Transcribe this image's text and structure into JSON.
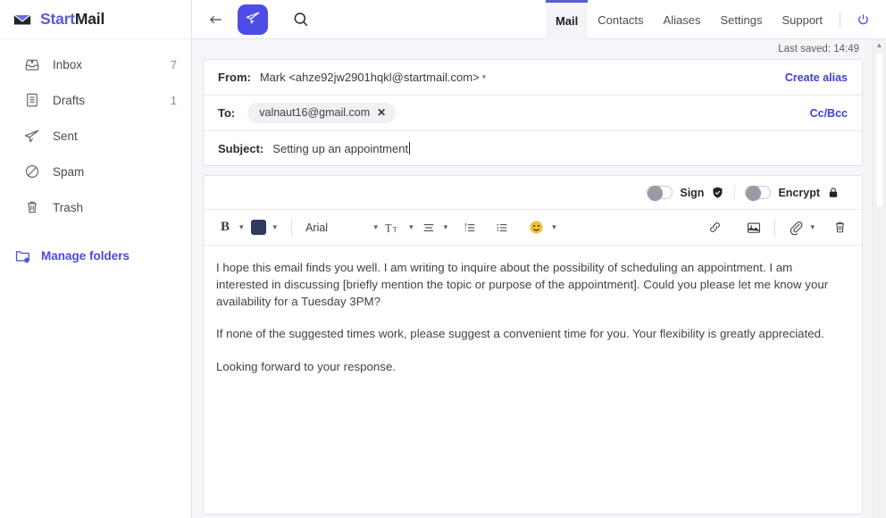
{
  "brand": {
    "start": "Start",
    "mail": "Mail",
    "logo_icon": "envelope-icon"
  },
  "sidebar": {
    "folders": [
      {
        "label": "Inbox",
        "count": "7",
        "icon": "inbox-tray-icon"
      },
      {
        "label": "Drafts",
        "count": "1",
        "icon": "document-icon"
      },
      {
        "label": "Sent",
        "count": "",
        "icon": "paper-plane-icon"
      },
      {
        "label": "Spam",
        "count": "",
        "icon": "no-entry-icon"
      },
      {
        "label": "Trash",
        "count": "",
        "icon": "trash-icon"
      }
    ],
    "manage_folders": {
      "label": "Manage folders",
      "icon": "folder-gear-icon"
    }
  },
  "topbar": {
    "back_icon": "back-arrow-icon",
    "send": {
      "label": "",
      "icon": "paper-plane-icon",
      "color": "#4d4de6"
    },
    "search_icon": "search-icon",
    "tabs": [
      {
        "label": "Mail",
        "active": true
      },
      {
        "label": "Contacts",
        "active": false
      },
      {
        "label": "Aliases",
        "active": false
      },
      {
        "label": "Settings",
        "active": false
      },
      {
        "label": "Support",
        "active": false
      }
    ],
    "power_icon": "power-icon",
    "active_tab_accent": "#5b5bd6"
  },
  "compose": {
    "last_saved": "Last saved: 14:49",
    "from": {
      "label": "From:",
      "value": "Mark <ahze92jw2901hqkl@startmail.com>",
      "dropdown_icon": "chevron-down-icon",
      "action": "Create alias"
    },
    "to": {
      "label": "To:",
      "recipients": [
        {
          "email": "valnaut16@gmail.com",
          "remove_icon": "close-icon"
        }
      ],
      "action": "Cc/Bcc"
    },
    "subject": {
      "label": "Subject:",
      "value": "Setting up an appointment"
    },
    "security": {
      "sign": {
        "label": "Sign",
        "on": false,
        "icon": "shield-check-icon"
      },
      "encrypt": {
        "label": "Encrypt",
        "on": false,
        "icon": "lock-icon"
      }
    },
    "toolbar": {
      "bold_icon": "bold-icon",
      "bold_chevron": "chevron-down-icon",
      "text_color": "#2f3a5c",
      "color_icon": "text-color-swatch-icon",
      "color_chevron": "chevron-down-icon",
      "font_family": "Arial",
      "font_chevron": "chevron-down-icon",
      "font_size_icon": "font-size-icon",
      "font_size_chevron": "chevron-down-icon",
      "align_icon": "align-left-icon",
      "align_chevron": "chevron-down-icon",
      "ordered_list_icon": "ordered-list-icon",
      "unordered_list_icon": "bullet-list-icon",
      "emoji_icon": "smiley-icon",
      "emoji_chevron": "chevron-down-icon",
      "link_icon": "link-icon",
      "image_icon": "image-icon",
      "attach_icon": "paperclip-icon",
      "attach_chevron": "chevron-down-icon",
      "delete_icon": "trash-icon"
    },
    "body": [
      "I hope this email finds you well. I am writing to inquire about the possibility of scheduling an appointment. I am interested in discussing [briefly mention the topic or purpose of the appointment]. Could you please let me know your availability for a Tuesday 3PM?",
      "If none of the suggested times work, please suggest a convenient time for you. Your flexibility is greatly appreciated.",
      "Looking forward to your response."
    ]
  },
  "scrollbar": {
    "up_arrow_icon": "triangle-up-icon"
  }
}
